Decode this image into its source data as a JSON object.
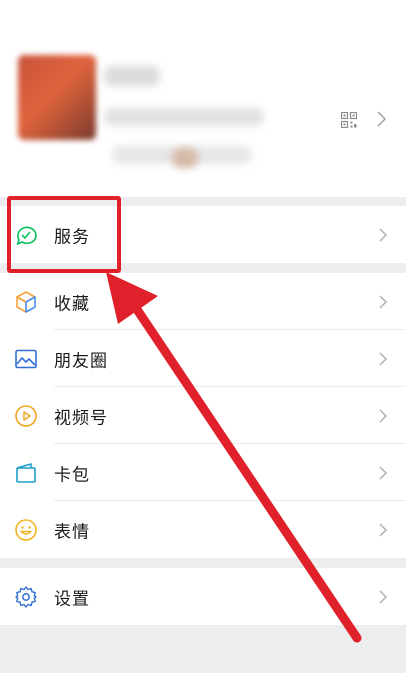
{
  "colors": {
    "background": "#ededed",
    "row_background": "#ffffff",
    "text": "#1a1a1a",
    "chevron": "#b0b0b0",
    "annotation_red": "#e0202a",
    "service_icon": "#07c160",
    "favorites_icon_orange": "#f7a338",
    "favorites_icon_blue": "#4d8ef0",
    "moments_icon": "#2f6fd6",
    "channels_icon": "#f2a521",
    "wallet_icon": "#1aa0c8",
    "stickers_icon": "#f2b31e",
    "settings_icon": "#2f6fd6"
  },
  "profile": {
    "qr_icon": "qr-code-icon",
    "chevron_icon": "chevron-right-icon"
  },
  "menu": {
    "service": {
      "label": "服务",
      "icon": "service-icon"
    },
    "group2": [
      {
        "key": "favorites",
        "label": "收藏",
        "icon": "favorites-cube-icon"
      },
      {
        "key": "moments",
        "label": "朋友圈",
        "icon": "moments-picture-icon"
      },
      {
        "key": "channels",
        "label": "视频号",
        "icon": "channels-play-icon"
      },
      {
        "key": "wallet",
        "label": "卡包",
        "icon": "wallet-card-icon"
      },
      {
        "key": "stickers",
        "label": "表情",
        "icon": "stickers-smile-icon"
      }
    ],
    "settings": {
      "label": "设置",
      "icon": "settings-gear-icon"
    }
  }
}
